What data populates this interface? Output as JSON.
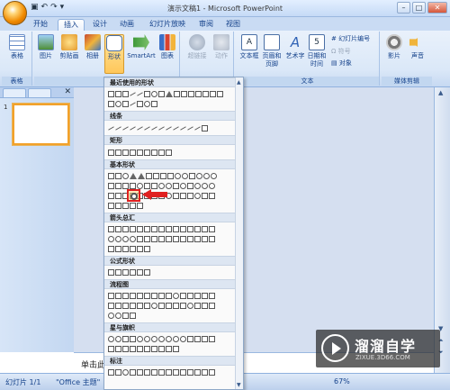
{
  "window": {
    "title": "演示文稿1 - Microsoft PowerPoint",
    "qat_icons": [
      "save-icon",
      "undo-icon",
      "redo-icon",
      "qat-dropdown-icon"
    ]
  },
  "tabs": [
    {
      "label": "开始",
      "active": false
    },
    {
      "label": "插入",
      "active": true
    },
    {
      "label": "设计",
      "active": false
    },
    {
      "label": "动画",
      "active": false
    },
    {
      "label": "幻灯片放映",
      "active": false
    },
    {
      "label": "审阅",
      "active": false
    },
    {
      "label": "视图",
      "active": false
    }
  ],
  "ribbon": {
    "groups": [
      {
        "label": "表格",
        "buttons": [
          "表格"
        ]
      },
      {
        "label": "插图",
        "buttons": [
          "图片",
          "剪贴画",
          "相册",
          "形状",
          "SmartArt",
          "图表"
        ]
      },
      {
        "label": "链接",
        "buttons": [
          "超链接",
          "动作"
        ]
      },
      {
        "label": "文本",
        "buttons": [
          "文本框",
          "页眉和页脚",
          "艺术字",
          "日期和时间"
        ],
        "small_buttons": [
          "幻灯片编号",
          "符号",
          "对象"
        ]
      },
      {
        "label": "媒体剪辑",
        "buttons": [
          "影片",
          "声音"
        ]
      }
    ]
  },
  "shapes_menu": {
    "sections": [
      "最近使用的形状",
      "线条",
      "矩形",
      "基本形状",
      "箭头总汇",
      "公式形状",
      "流程图",
      "星与旗帜",
      "标注"
    ]
  },
  "left_panel": {
    "slide_number": "1"
  },
  "notes": {
    "placeholder": "单击此处添加备注"
  },
  "statusbar": {
    "slide_info": "幻灯片 1/1",
    "theme": "\"Office 主题\"",
    "zoom": "67%"
  },
  "watermark": {
    "brand": "溜溜自学",
    "url": "ZIXUE.3D66.COM"
  },
  "colors": {
    "accent_orange": "#f2a12a",
    "highlight_red": "#e02020",
    "ribbon_blue": "#dbe8f8"
  }
}
